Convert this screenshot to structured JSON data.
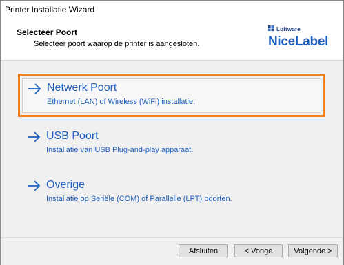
{
  "window": {
    "title": "Printer Installatie Wizard"
  },
  "header": {
    "title": "Selecteer Poort",
    "subtitle": "Selecteer poort waarop de printer is aangesloten.",
    "logo_top": "Loftware",
    "logo_main": "NiceLabel",
    "logo_color": "#1f5fbf"
  },
  "options": [
    {
      "icon": "arrow-right-icon",
      "label": "Netwerk Poort",
      "description": "Ethernet (LAN) of Wireless (WiFi) installatie.",
      "selected": true
    },
    {
      "icon": "arrow-right-icon",
      "label": "USB Poort",
      "description": "Installatie van USB Plug-and-play apparaat.",
      "selected": false
    },
    {
      "icon": "arrow-right-icon",
      "label": "Overige",
      "description": "Installatie op Seriële (COM) of Parallelle (LPT) poorten.",
      "selected": false
    }
  ],
  "highlight_color": "#f07f1e",
  "footer": {
    "close_label": "Afsluiten",
    "back_label": "< Vorige",
    "next_label": "Volgende >"
  }
}
